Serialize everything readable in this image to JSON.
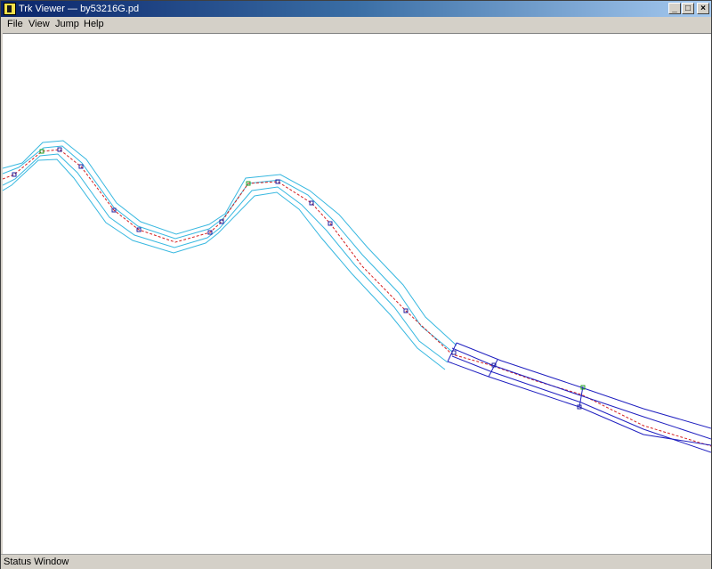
{
  "window": {
    "title": "Trk Viewer — by53216G.pd",
    "minimize_glyph": "_",
    "maximize_glyph": "□",
    "close_glyph": "×"
  },
  "menu": {
    "file": "File",
    "view": "View",
    "jump": "Jump",
    "help": "Help"
  },
  "status": {
    "text": "Status Window"
  },
  "colors": {
    "centerline": "#d42020",
    "road_edge": "#38b8e0",
    "ramp_edge": "#2020c0",
    "marker": "#2020a0",
    "marker_green": "#20a020"
  }
}
